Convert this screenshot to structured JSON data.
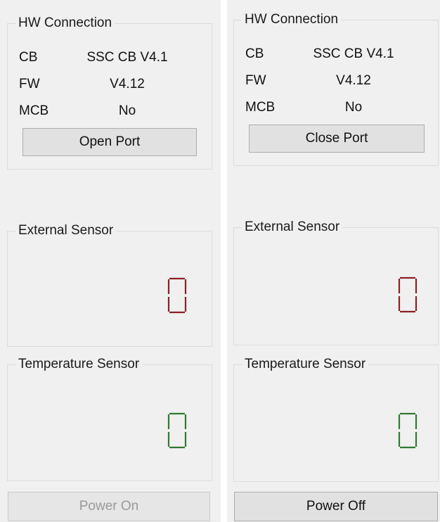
{
  "colors": {
    "external_digit": "#8b1f24",
    "temperature_digit": "#2f7a2f"
  },
  "left_panel": {
    "hw_connection": {
      "title": "HW Connection",
      "rows": [
        {
          "label": "CB",
          "value": "SSC CB V4.1"
        },
        {
          "label": "FW",
          "value": "V4.12"
        },
        {
          "label": "MCB",
          "value": "No"
        }
      ],
      "port_button": "Open Port"
    },
    "external_sensor": {
      "title": "External Sensor",
      "value": 0
    },
    "temperature_sensor": {
      "title": "Temperature  Sensor",
      "value": 0
    },
    "power_button": {
      "label": "Power On",
      "enabled": false
    }
  },
  "right_panel": {
    "hw_connection": {
      "title": "HW Connection",
      "rows": [
        {
          "label": "CB",
          "value": "SSC CB V4.1"
        },
        {
          "label": "FW",
          "value": "V4.12"
        },
        {
          "label": "MCB",
          "value": "No"
        }
      ],
      "port_button": "Close Port"
    },
    "external_sensor": {
      "title": "External Sensor",
      "value": 0
    },
    "temperature_sensor": {
      "title": "Temperature  Sensor",
      "value": 0
    },
    "power_button": {
      "label": "Power Off",
      "enabled": true
    }
  }
}
